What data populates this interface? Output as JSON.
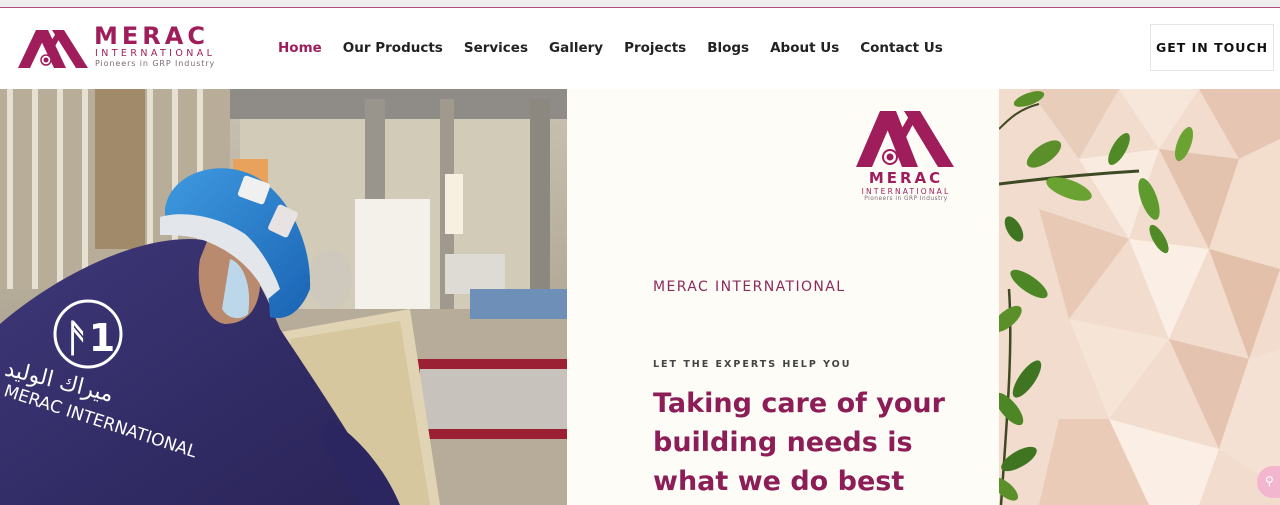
{
  "brand": {
    "name": "MERAC",
    "subtitle": "INTERNATIONAL",
    "tagline": "Pioneers in GRP Industry",
    "colors": {
      "primary": "#a01d5c",
      "headline": "#8c1d56"
    }
  },
  "nav": {
    "items": [
      {
        "label": "Home",
        "active": true
      },
      {
        "label": "Our Products"
      },
      {
        "label": "Services"
      },
      {
        "label": "Gallery"
      },
      {
        "label": "Projects"
      },
      {
        "label": "Blogs"
      },
      {
        "label": "About Us"
      },
      {
        "label": "Contact Us"
      }
    ]
  },
  "cta": {
    "label": "GET IN TOUCH"
  },
  "hero": {
    "company": "MERAC INTERNATIONAL",
    "kicker": "LET THE EXPERTS HELP YOU",
    "headline_lines": [
      "Taking care of your",
      "building needs is",
      "what we do best"
    ],
    "jacket_arabic": "ميراك الوليد",
    "jacket_latin": "MERAC INTERNATIONAL"
  },
  "icons": {
    "logo": "merac-logo-mark",
    "accessibility": "accessibility-icon"
  }
}
